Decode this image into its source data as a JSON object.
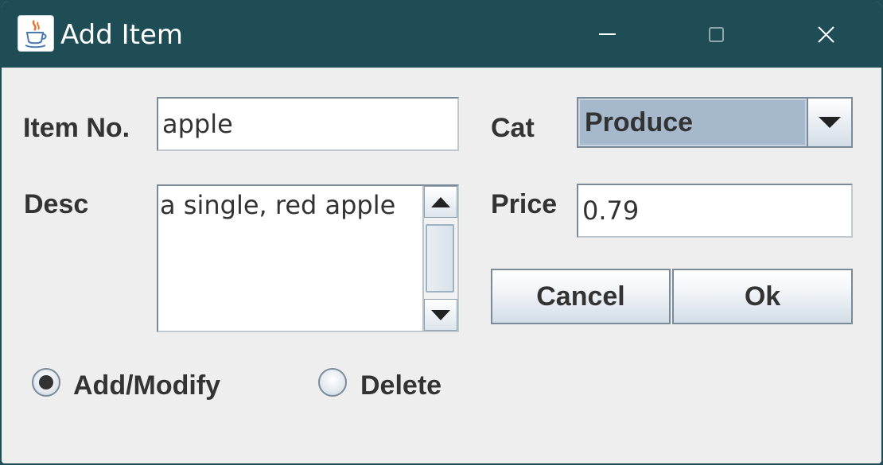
{
  "window": {
    "title": "Add Item",
    "app_icon": "java-cup-icon",
    "controls": [
      "minimize-icon",
      "maximize-icon",
      "close-icon"
    ],
    "titlebar_color": "#1f4d56"
  },
  "form": {
    "item_no": {
      "label": "Item No.",
      "value": "apple"
    },
    "desc": {
      "label": "Desc",
      "value": "a single, red apple"
    },
    "cat": {
      "label": "Cat",
      "selected": "Produce"
    },
    "price": {
      "label": "Price",
      "value": "0.79"
    }
  },
  "buttons": {
    "cancel": "Cancel",
    "ok": "Ok"
  },
  "radios": [
    {
      "label": "Add/Modify",
      "selected": true
    },
    {
      "label": "Delete",
      "selected": false
    }
  ]
}
